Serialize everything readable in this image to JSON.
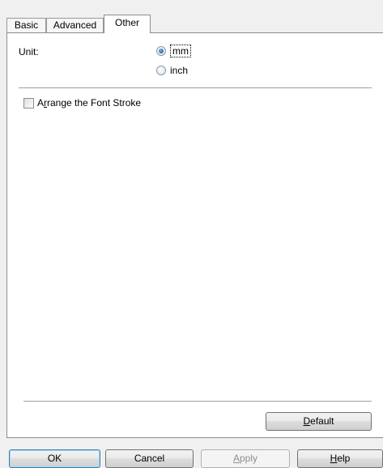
{
  "tabs": [
    {
      "label": "Basic",
      "active": false
    },
    {
      "label": "Advanced",
      "active": false
    },
    {
      "label": "Other",
      "active": true
    }
  ],
  "unit": {
    "label": "Unit:",
    "options": [
      {
        "label": "mm",
        "checked": true
      },
      {
        "label": "inch",
        "checked": false
      }
    ]
  },
  "font_stroke": {
    "label_prefix": "A",
    "label_mnemonic": "r",
    "label_rest": "range the Font Stroke",
    "checked": false
  },
  "buttons": {
    "default_mnemonic": "D",
    "default_rest": "efault",
    "ok": "OK",
    "cancel": "Cancel",
    "apply_mnemonic": "A",
    "apply_rest": "pply",
    "help_mnemonic": "H",
    "help_rest": "elp"
  },
  "colors": {
    "background": "#f0f0f0",
    "panel": "#ffffff",
    "radio_selected": "#1f5fa8",
    "disabled_text": "#8d8d8d"
  }
}
